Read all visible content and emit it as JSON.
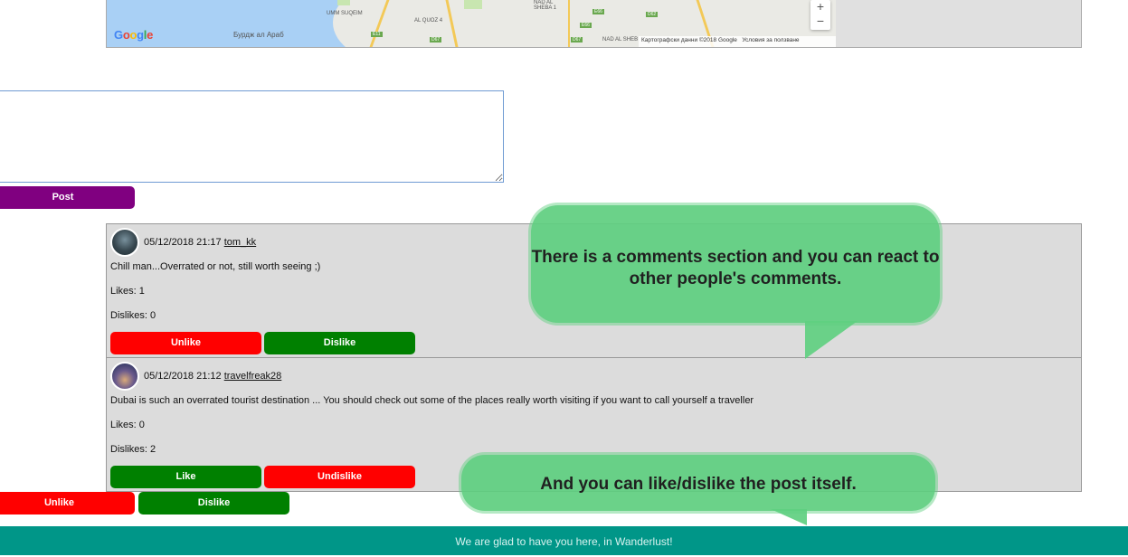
{
  "map": {
    "logo": "Google",
    "attribution": "Картографски данни ©2018 Google",
    "terms": "Условия за ползване",
    "zoom_in": "+",
    "zoom_out": "−",
    "labels": {
      "umm_suqeim": "UMM SUQEIM",
      "burj": "Бурдж ал Араб",
      "al_quoz": "AL QUOZ 4",
      "nad_al_sheba": "NAD AL SHEBA 1",
      "nad_al_sheb": "NAD AL SHEB"
    },
    "shields": {
      "e11": "E11",
      "d67a": "D67",
      "d67b": "D67",
      "e66a": "E66",
      "e66b": "E66",
      "d62": "D62"
    }
  },
  "comment_form": {
    "textarea_value": "",
    "post_label": "Post"
  },
  "comments": [
    {
      "timestamp": "05/12/2018 21:17",
      "user": "tom_kk",
      "text": "Chill man...Overrated or not, still worth seeing ;)",
      "likes": "Likes: 1",
      "dislikes": "Dislikes: 0",
      "button1": "Unlike",
      "button2": "Dislike"
    },
    {
      "timestamp": "05/12/2018 21:12",
      "user": "travelfreak28",
      "text": "Dubai is such an overrated tourist destination ... You should check out some of the places really worth visiting if you want to call yourself a traveller",
      "likes": "Likes: 0",
      "dislikes": "Dislikes: 2",
      "button1": "Like",
      "button2": "Undislike"
    }
  ],
  "post_actions": {
    "unlike": "Unlike",
    "dislike": "Dislike"
  },
  "callouts": {
    "comments": "There is a comments section and you can react to other people's comments.",
    "post": "And you can like/dislike the post itself."
  },
  "footer": {
    "text": "We are glad to have you here, in Wanderlust!"
  },
  "colors": {
    "purple": "#800080",
    "red": "#ff0000",
    "green": "#008000",
    "teal": "#009688",
    "callout": "#5fcf80"
  }
}
